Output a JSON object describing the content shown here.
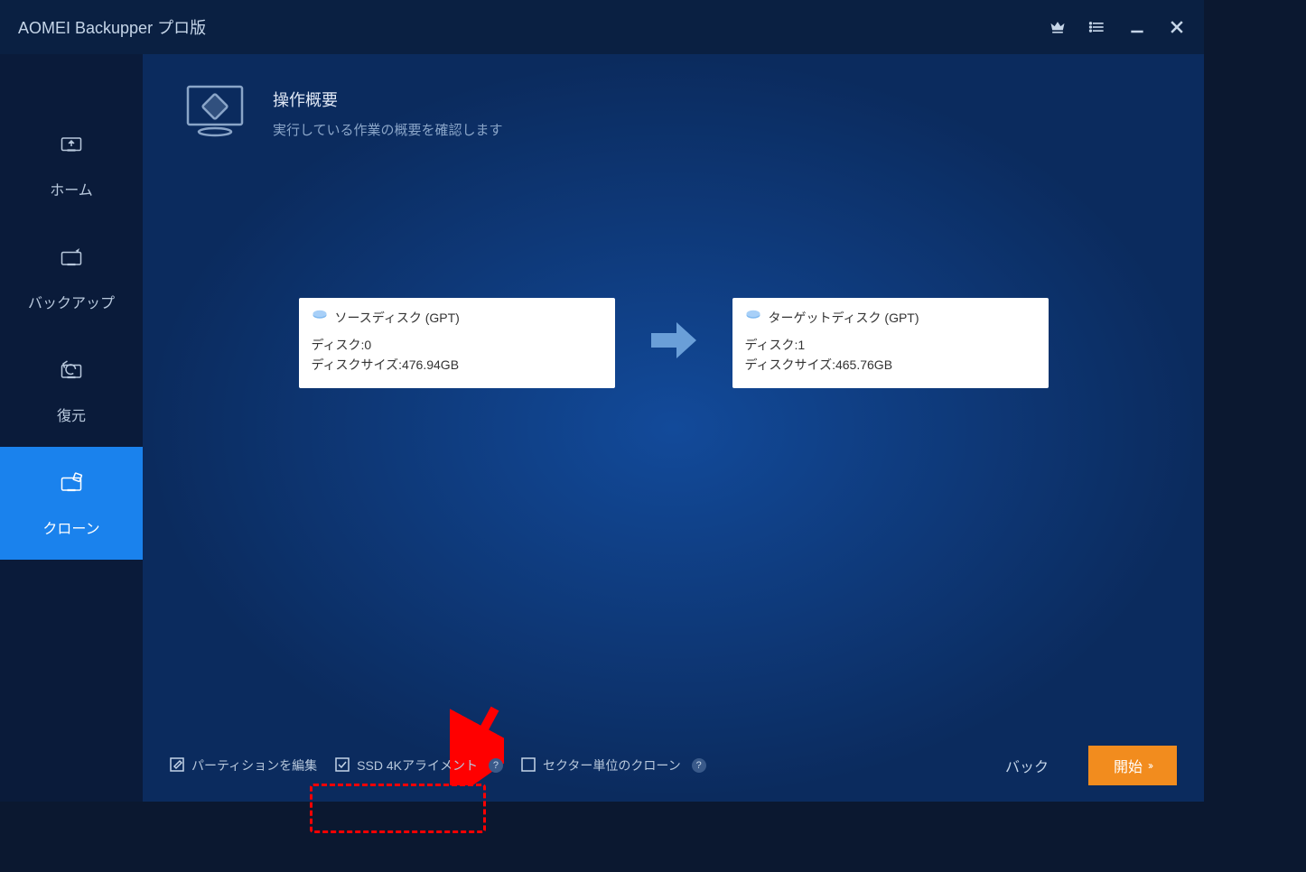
{
  "app": {
    "title": "AOMEI Backupper プロ版"
  },
  "sidebar": {
    "items": [
      {
        "label": "ホーム"
      },
      {
        "label": "バックアップ"
      },
      {
        "label": "復元"
      },
      {
        "label": "クローン"
      }
    ]
  },
  "header": {
    "title": "操作概要",
    "subtitle": "実行している作業の概要を確認します"
  },
  "source_disk": {
    "title": "ソースディスク (GPT)",
    "line1": "ディスク:0",
    "line2": "ディスクサイズ:476.94GB"
  },
  "target_disk": {
    "title": "ターゲットディスク (GPT)",
    "line1": "ディスク:1",
    "line2": "ディスクサイズ:465.76GB"
  },
  "footer": {
    "edit_partition": "パーティションを編集",
    "ssd_4k": "SSD 4Kアライメント",
    "sector_clone": "セクター単位のクローン",
    "back": "バック",
    "start": "開始"
  }
}
